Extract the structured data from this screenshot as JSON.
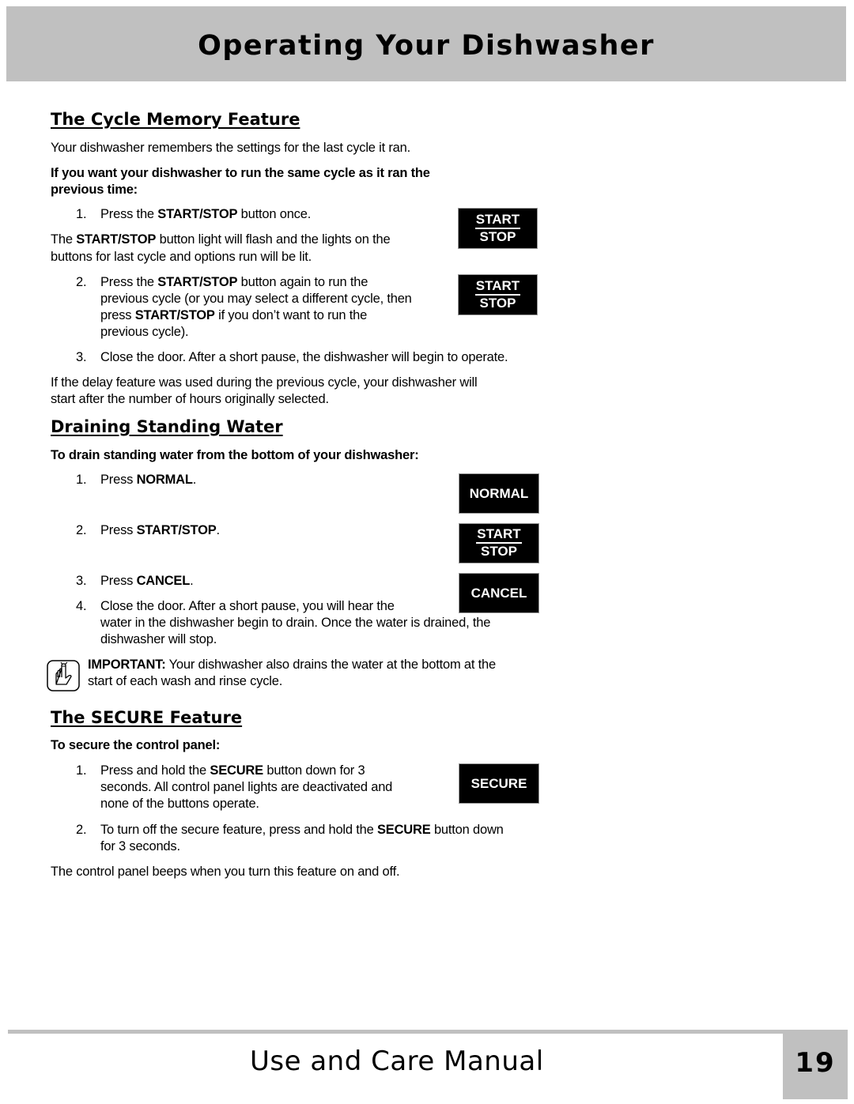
{
  "header": {
    "title": "Operating Your Dishwasher"
  },
  "cycle_memory": {
    "heading": "The Cycle Memory Feature",
    "intro": "Your dishwasher remembers the settings for the last cycle it ran.",
    "instruction_line1": "If you want your dishwasher to run the same cycle as it ran the",
    "instruction_line2": "previous time:",
    "step1": {
      "num": "1.",
      "pre": "Press the ",
      "bold": "START/STOP",
      "post": " button once."
    },
    "note": {
      "pre": "The ",
      "bold": "START/STOP",
      "post": " button light will flash and the lights on the",
      "line2": "buttons for last cycle and options run will be lit."
    },
    "step2": {
      "num": "2.",
      "line1_pre": "Press the ",
      "line1_bold": "START/STOP",
      "line1_post": " button again to run the",
      "line2": "previous cycle (or you may select a different cycle, then",
      "line3_pre": "press ",
      "line3_bold": "START/STOP",
      "line3_post": " if you don’t want to run the",
      "line4": "previous cycle)."
    },
    "step3": {
      "num": "3.",
      "text": "Close the door. After a short pause, the dishwasher will begin to operate."
    },
    "delay_note_line1": "If the delay feature was used during the previous cycle, your dishwasher will",
    "delay_note_line2": "start after the number of hours originally selected."
  },
  "draining": {
    "heading": "Draining Standing Water",
    "instruction": "To drain standing water from the bottom of your dishwasher:",
    "step1": {
      "num": "1.",
      "pre": "Press ",
      "bold": "NORMAL",
      "post": "."
    },
    "step2": {
      "num": "2.",
      "pre": "Press ",
      "bold": "START/STOP",
      "post": "."
    },
    "step3": {
      "num": "3.",
      "pre": "Press ",
      "bold": "CANCEL",
      "post": "."
    },
    "step4": {
      "num": "4.",
      "line1": "Close the door. After a short pause, you will hear the",
      "line2": "water in the dishwasher begin to drain. Once the water is drained, the",
      "line3": "dishwasher will stop."
    },
    "important": {
      "label": "IMPORTANT:",
      "line1": " Your dishwasher also drains the water at the bottom at the",
      "line2": "start of each wash and rinse cycle."
    }
  },
  "secure": {
    "heading": "The SECURE Feature",
    "instruction": "To secure the control panel:",
    "step1": {
      "num": "1.",
      "line1_pre": "Press and hold the ",
      "line1_bold": "SECURE",
      "line1_post": " button down for 3",
      "line2": "seconds. All control panel lights are deactivated and",
      "line3": "none of the buttons operate."
    },
    "step2": {
      "num": "2.",
      "line1_pre": "To turn off the secure feature, press and hold the ",
      "line1_bold": "SECURE",
      "line1_post": " button down",
      "line2": "for 3 seconds."
    },
    "closing": "The control panel beeps when you turn this feature on and off."
  },
  "buttons": {
    "start": "START",
    "stop": "STOP",
    "normal": "NORMAL",
    "cancel": "CANCEL",
    "secure": "SECURE"
  },
  "icons": {
    "important_note": "reminder-finger-icon"
  },
  "footer": {
    "title": "Use and Care Manual",
    "page_number": "19"
  },
  "colors": {
    "header_bg": "#c0c0c0",
    "button_bg": "#000000",
    "button_text": "#ffffff"
  }
}
